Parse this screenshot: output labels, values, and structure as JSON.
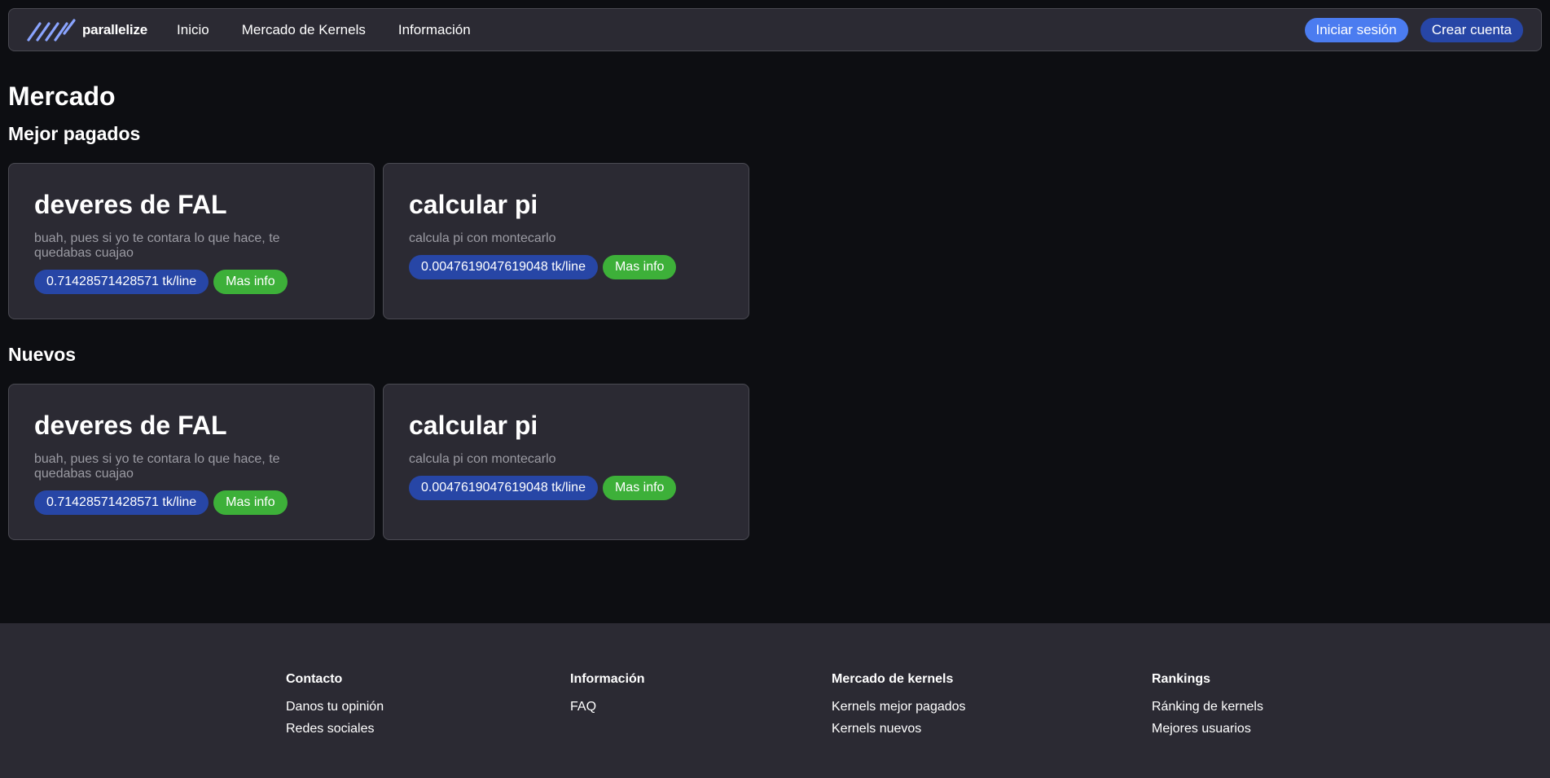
{
  "nav": {
    "brand": "parallelize",
    "links": [
      "Inicio",
      "Mercado de Kernels",
      "Información"
    ],
    "login_label": "Iniciar sesión",
    "signup_label": "Crear cuenta",
    "colors": {
      "login": "#4b7cf0",
      "signup": "#2746a6"
    }
  },
  "main": {
    "title": "Mercado",
    "sections": [
      {
        "title": "Mejor pagados",
        "cards": [
          {
            "title": "deveres de FAL",
            "description": "buah, pues si yo te contara lo que hace, te quedabas cuajao",
            "price": "0.71428571428571 tk/line",
            "action": "Mas info"
          },
          {
            "title": "calcular pi",
            "description": "calcula pi con montecarlo",
            "price": "0.0047619047619048 tk/line",
            "action": "Mas info"
          }
        ]
      },
      {
        "title": "Nuevos",
        "cards": [
          {
            "title": "deveres de FAL",
            "description": "buah, pues si yo te contara lo que hace, te quedabas cuajao",
            "price": "0.71428571428571 tk/line",
            "action": "Mas info"
          },
          {
            "title": "calcular pi",
            "description": "calcula pi con montecarlo",
            "price": "0.0047619047619048 tk/line",
            "action": "Mas info"
          }
        ]
      }
    ],
    "colors": {
      "price_badge": "#2746a6",
      "info_button": "#3db039"
    }
  },
  "footer": {
    "columns": [
      {
        "heading": "Contacto",
        "links": [
          "Danos tu opinión",
          "Redes sociales"
        ]
      },
      {
        "heading": "Información",
        "links": [
          "FAQ"
        ]
      },
      {
        "heading": "Mercado de kernels",
        "links": [
          "Kernels mejor pagados",
          "Kernels nuevos"
        ]
      },
      {
        "heading": "Rankings",
        "links": [
          "Ránking de kernels",
          "Mejores usuarios"
        ]
      }
    ]
  }
}
